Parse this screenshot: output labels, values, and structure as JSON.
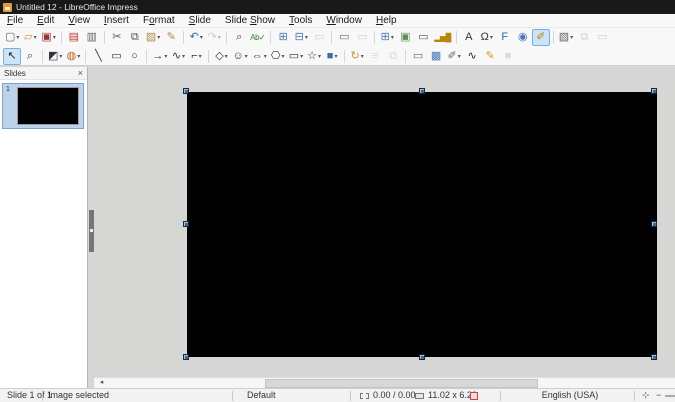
{
  "colors": {
    "titlebar": "#191919",
    "toolbar_active_bg": "#cde4f7",
    "workspace": "#d6d6d4",
    "slide_fill": "#000000",
    "selection_handle": "#44688e",
    "slide_selected_bg": "#bcd3ec"
  },
  "titlebar": {
    "title": "Untitled 12 - LibreOffice Impress"
  },
  "menubar": {
    "items": [
      {
        "label": "File",
        "mnemonic": 0
      },
      {
        "label": "Edit",
        "mnemonic": 0
      },
      {
        "label": "View",
        "mnemonic": 0
      },
      {
        "label": "Insert",
        "mnemonic": 0
      },
      {
        "label": "Format",
        "mnemonic": 1
      },
      {
        "label": "Slide",
        "mnemonic": 0
      },
      {
        "label": "Slide Show",
        "mnemonic": 6
      },
      {
        "label": "Tools",
        "mnemonic": 0
      },
      {
        "label": "Window",
        "mnemonic": 0
      },
      {
        "label": "Help",
        "mnemonic": 0
      }
    ]
  },
  "toolbar_standard": {
    "items": [
      {
        "name": "new-document",
        "glyph": "▢",
        "color": "#666666",
        "dropdown": true
      },
      {
        "name": "open-file",
        "glyph": "▱",
        "color": "#c9952c",
        "dropdown": true
      },
      {
        "name": "save",
        "glyph": "▣",
        "color": "#993333",
        "dropdown": true,
        "sep": true
      },
      {
        "name": "export-pdf",
        "glyph": "▤",
        "color": "#c0392b"
      },
      {
        "name": "print",
        "glyph": "▥",
        "color": "#666666",
        "sep": true
      },
      {
        "name": "cut",
        "glyph": "✂",
        "color": "#555555"
      },
      {
        "name": "copy",
        "glyph": "⧉",
        "color": "#555555"
      },
      {
        "name": "paste",
        "glyph": "▨",
        "color": "#b08d4f",
        "dropdown": true
      },
      {
        "name": "clone-formatting",
        "glyph": "✎",
        "color": "#b08d4f",
        "sep": true
      },
      {
        "name": "undo",
        "glyph": "↶",
        "color": "#2e6da4",
        "dropdown": true
      },
      {
        "name": "redo",
        "glyph": "↷",
        "color": "#8899aa",
        "dropdown": true,
        "disabled": true,
        "sep": true
      },
      {
        "name": "find-and-replace",
        "glyph": "⌕",
        "color": "#444444"
      },
      {
        "name": "spelling",
        "glyph": "Ab✓",
        "color": "#2e7d32",
        "sep": true
      },
      {
        "name": "display-grid",
        "glyph": "⊞",
        "color": "#4a7ab5"
      },
      {
        "name": "display-views",
        "glyph": "⊟",
        "color": "#4a7ab5",
        "dropdown": true
      },
      {
        "name": "display-comments",
        "glyph": "▭",
        "color": "#99a5b1",
        "disabled": true,
        "sep": true
      },
      {
        "name": "master-slide",
        "glyph": "▭",
        "color": "#666666"
      },
      {
        "name": "start-from-first-slide",
        "glyph": "▭",
        "color": "#99a5b1",
        "disabled": true,
        "sep": true
      },
      {
        "name": "insert-table",
        "glyph": "⊞",
        "color": "#4a7ab5",
        "dropdown": true
      },
      {
        "name": "insert-image",
        "glyph": "▣",
        "color": "#5d8f53"
      },
      {
        "name": "insert-text-box",
        "glyph": "▭",
        "color": "#555555"
      },
      {
        "name": "insert-chart",
        "glyph": "▂▅█",
        "color": "#b8860b",
        "sep": true
      },
      {
        "name": "insert-textbox-a",
        "glyph": "A",
        "color": "#333333"
      },
      {
        "name": "insert-special-character",
        "glyph": "Ω",
        "color": "#333333",
        "dropdown": true
      },
      {
        "name": "insert-fontwork",
        "glyph": "F",
        "color": "#2e6da4"
      },
      {
        "name": "insert-hyperlink",
        "glyph": "◉",
        "color": "#4a7ab5"
      },
      {
        "name": "show-draw-functions",
        "glyph": "✐",
        "color": "#b8860b",
        "active": true,
        "sep": true
      },
      {
        "name": "new-slide",
        "glyph": "▧",
        "color": "#666666",
        "dropdown": true
      },
      {
        "name": "duplicate-slide",
        "glyph": "⧉",
        "color": "#99a5b1",
        "disabled": true
      },
      {
        "name": "rename-slide",
        "glyph": "▭",
        "color": "#99a5b1",
        "disabled": true
      }
    ]
  },
  "toolbar_drawing": {
    "items": [
      {
        "name": "select",
        "glyph": "↖",
        "color": "#222222",
        "active": true
      },
      {
        "name": "zoom-pan",
        "glyph": "⌕",
        "color": "#444444",
        "sep": true
      },
      {
        "name": "line-color",
        "glyph": "◩",
        "color": "#333344",
        "dropdown": true
      },
      {
        "name": "fill-color",
        "glyph": "◍",
        "color": "#b5651d",
        "dropdown": true,
        "sep": true
      },
      {
        "name": "insert-line",
        "glyph": "╲",
        "color": "#333333"
      },
      {
        "name": "rectangle",
        "glyph": "▭",
        "color": "#333333"
      },
      {
        "name": "ellipse",
        "glyph": "○",
        "color": "#333333",
        "sep": true
      },
      {
        "name": "lines-and-arrows",
        "glyph": "→",
        "color": "#333333",
        "dropdown": true
      },
      {
        "name": "curve-polygon",
        "glyph": "∿",
        "color": "#333333",
        "dropdown": true
      },
      {
        "name": "connectors",
        "glyph": "⌐",
        "color": "#333333",
        "dropdown": true,
        "sep": true
      },
      {
        "name": "basic-shapes",
        "glyph": "◇",
        "color": "#333333",
        "dropdown": true
      },
      {
        "name": "symbol-shapes",
        "glyph": "☺",
        "color": "#333333",
        "dropdown": true
      },
      {
        "name": "block-arrows",
        "glyph": "⇔",
        "color": "#333333",
        "dropdown": true
      },
      {
        "name": "flowchart-shapes",
        "glyph": "⎔",
        "color": "#333333",
        "dropdown": true
      },
      {
        "name": "callout-shapes",
        "glyph": "▭",
        "color": "#333333",
        "dropdown": true
      },
      {
        "name": "star-shapes",
        "glyph": "☆",
        "color": "#333333",
        "dropdown": true
      },
      {
        "name": "3d-objects",
        "glyph": "■",
        "color": "#3b6ea5",
        "dropdown": true,
        "sep": true
      },
      {
        "name": "rotate",
        "glyph": "↻",
        "color": "#c9952c",
        "dropdown": true
      },
      {
        "name": "align-objects",
        "glyph": "≡",
        "color": "#b0b0b0",
        "disabled": true
      },
      {
        "name": "arrange",
        "glyph": "⧉",
        "color": "#b0b0b0",
        "disabled": true,
        "sep": true
      },
      {
        "name": "shadow",
        "glyph": "▭",
        "color": "#666666"
      },
      {
        "name": "crop-image",
        "glyph": "▩",
        "color": "#4a7ab5"
      },
      {
        "name": "image-filter",
        "glyph": "✐",
        "color": "#666666",
        "dropdown": true
      },
      {
        "name": "points",
        "glyph": "∿",
        "color": "#222222"
      },
      {
        "name": "glue-points",
        "glyph": "✎",
        "color": "#d4a017"
      },
      {
        "name": "toggle-extrusion",
        "glyph": "■",
        "color": "#b9b9b9",
        "disabled": true
      }
    ]
  },
  "slides_panel": {
    "title": "Slides",
    "close_glyph": "×",
    "slides": [
      {
        "number": "1",
        "selected": true
      }
    ]
  },
  "scrollbar": {
    "left_arrow_glyph": "◂"
  },
  "statusbar": {
    "slide_indicator": "Slide 1 of 1",
    "selection_status": "Image selected",
    "template_name": "Default",
    "cursor_position": "0.00 / 0.00",
    "object_size": "11.02 x 6.20",
    "language": "English (USA)",
    "fit_slide_glyph": "⊹",
    "zoom_out_glyph": "−"
  }
}
